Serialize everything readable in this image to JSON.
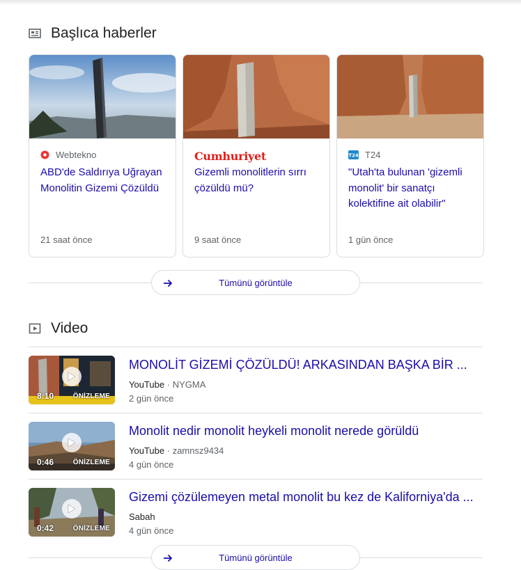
{
  "top_stories": {
    "title": "Başlıca haberler",
    "icon": "newspaper-icon",
    "cards": [
      {
        "source": "Webtekno",
        "source_icon": "webtekno-logo-icon",
        "title": "ABD'de Saldırıya Uğrayan Monolitin Gizemi Çözüldü",
        "time": "21 saat önce"
      },
      {
        "source": "Cumhuriyet",
        "source_icon": "cumhuriyet-logo-icon",
        "title": "Gizemli monolitlerin sırrı çözüldü mü?",
        "time": "9 saat önce"
      },
      {
        "source": "T24",
        "source_icon": "t24-logo-icon",
        "title": "\"Utah'ta bulunan 'gizemli monolit' bir sanatçı kolektifine ait olabilir\"",
        "time": "1 gün önce"
      }
    ],
    "see_all": "Tümünü görüntüle"
  },
  "videos": {
    "title": "Video",
    "icon": "play-box-icon",
    "items": [
      {
        "title": "MONOLİT GİZEMİ ÇÖZÜLDÜ! ARKASINDAN BAŞKA BİR ...",
        "platform": "YouTube",
        "separator": "·",
        "channel": "NYGMA",
        "time": "2 gün önce",
        "duration": "8:10",
        "preview": "ÖNİZLEME"
      },
      {
        "title": "Monolit nedir monolit heykeli monolit nerede görüldü",
        "platform": "YouTube",
        "separator": "·",
        "channel": "zamnsz9434",
        "time": "4 gün önce",
        "duration": "0:46",
        "preview": "ÖNİZLEME"
      },
      {
        "title": "Gizemi çözülemeyen metal monolit bu kez de Kaliforniya'da ...",
        "platform": "Sabah",
        "separator": "",
        "channel": "",
        "time": "4 gün önce",
        "duration": "0:42",
        "preview": "ÖNİZLEME"
      }
    ],
    "see_all": "Tümünü görüntüle"
  },
  "colors": {
    "link": "#1a0dab",
    "meta": "#5f6368",
    "border": "#dadce0"
  }
}
